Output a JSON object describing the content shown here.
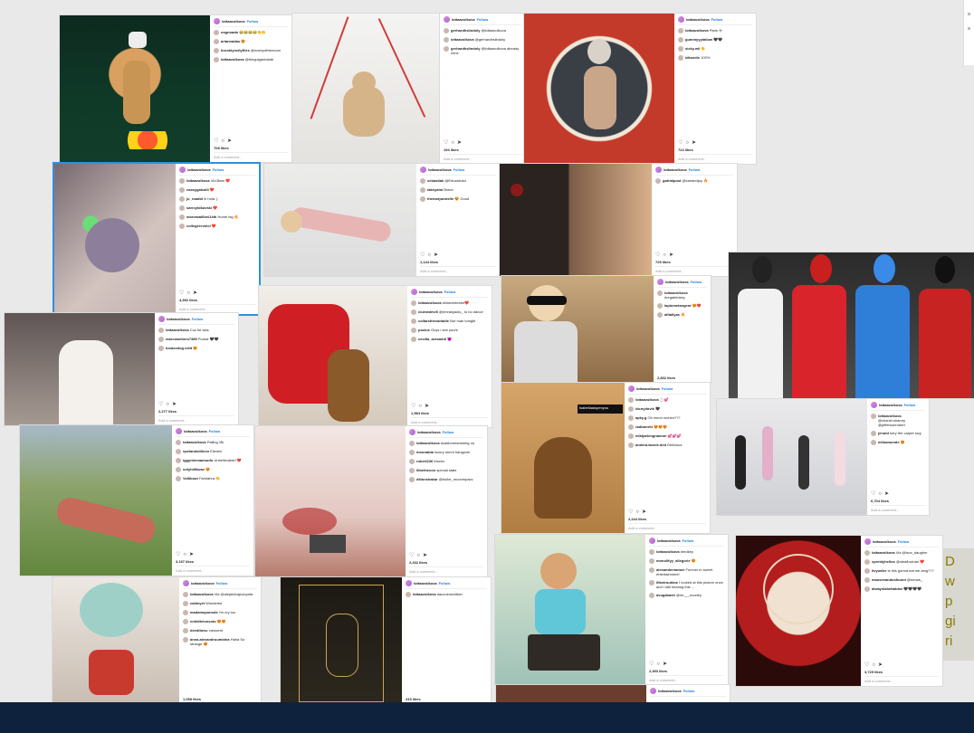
{
  "cards": [
    {
      "account": "lottaavolkova",
      "follow": "Follow",
      "comments": [
        {
          "user": "osgnoada",
          "text": "😂😂😂😂👏👏"
        },
        {
          "user": "ariannadas",
          "text": "😍"
        },
        {
          "user": "brooklyncityfiles",
          "text": "@marryofthemoon"
        },
        {
          "user": "lottaavolkova",
          "text": "@theguigantolate"
        }
      ],
      "likes": "708 likes",
      "add": "Add a comment..."
    },
    {
      "account": "",
      "follow": "",
      "comments": [],
      "likes": "",
      "add": ""
    },
    {
      "account": "lottaavolkova",
      "follow": "Follow",
      "comments": [
        {
          "user": "gerhardhslindoly",
          "text": "@lottaavolkova"
        },
        {
          "user": "lottaavolkova",
          "text": "@gerhardhslindoly"
        },
        {
          "user": "gerhardhslindoly",
          "text": "@lottaavolkova already mine"
        }
      ],
      "likes": "194 likes",
      "add": "Add a comment..."
    },
    {
      "account": "lottaavolkova",
      "follow": "Follow",
      "comments": [
        {
          "user": "lottaavolkova",
          "text": "Paris 💀"
        },
        {
          "user": "gummyyytallow",
          "text": "🖤🖤"
        },
        {
          "user": "sicky.wii",
          "text": "👏"
        },
        {
          "user": "idksmile",
          "text": "100%"
        }
      ],
      "likes": "724 likes",
      "add": "Add a comment..."
    },
    {
      "account": "lottaavolkova",
      "follow": "Follow",
      "comments": [
        {
          "user": "lottaavolkova",
          "text": "Vid.Bear ❤️"
        },
        {
          "user": "cassygalcalli",
          "text": "❤️"
        },
        {
          "user": "ju_roadid",
          "text": "hi hola :)"
        },
        {
          "user": "sarrcyldkovski",
          "text": "❤️"
        },
        {
          "user": "stonewalllbei14th",
          "text": "Home big 🔥"
        },
        {
          "user": "collegerevolcl",
          "text": "❤️"
        }
      ],
      "likes": "4,392 likes",
      "add": "Add a comment..."
    },
    {
      "account": "lottaavolkova",
      "follow": "Follow",
      "comments": [
        {
          "user": "sebastiak",
          "text": "@Eduardosd"
        },
        {
          "user": "takeyaim",
          "text": "Bravo"
        },
        {
          "user": "themarjaestelle",
          "text": "😍 Good"
        }
      ],
      "likes": "1,144 likes",
      "add": "Add a comment..."
    },
    {
      "account": "lottaavolkova",
      "follow": "Follow",
      "comments": [
        {
          "user": "gatrialpost",
          "text": "@carlandjoy 🔥"
        }
      ],
      "likes": "725 likes",
      "add": "Add a comment..."
    },
    {
      "account": "lottaavolkova",
      "follow": "Follow",
      "comments": [
        {
          "user": "lottaavolkova",
          "text": "Cuz he was"
        },
        {
          "user": "marcowebers7385",
          "text": "Poona 🖤🖤"
        },
        {
          "user": "lunaxedog.ezitt",
          "text": "😍"
        }
      ],
      "likes": "2,277 likes",
      "add": "Add a comment..."
    },
    {
      "account": "lottaavolkova",
      "follow": "Follow",
      "comments": [
        {
          "user": "lottaavolkova",
          "text": "#limezeitenhe❤️"
        },
        {
          "user": "cluestdevill",
          "text": "@emranjacks_ to no dance"
        },
        {
          "user": "collarsthevariable",
          "text": "Not man tonight"
        },
        {
          "user": "pociux",
          "text": "Guys i see yours"
        },
        {
          "user": "cecilia_avramidi",
          "text": "😈"
        }
      ],
      "likes": "1,984 likes",
      "add": "Add a comment..."
    },
    {
      "account": "lottaavolkova",
      "follow": "Follow",
      "comments": [
        {
          "user": "lottaavolkova",
          "text": "#regalelokey"
        },
        {
          "user": "laplumetangent",
          "text": "😍❤️"
        },
        {
          "user": "alltallyas",
          "text": "🔥"
        }
      ],
      "likes": "2,832 likes",
      "add": "Add a comment..."
    },
    {
      "account": "",
      "follow": "",
      "comments": [],
      "likes": "",
      "add": ""
    },
    {
      "account": "lottaavolkova",
      "follow": "Follow",
      "comments": [
        {
          "user": "lottaavolkova",
          "text": "💍💕"
        },
        {
          "user": "idcnydovik",
          "text": "🖤"
        },
        {
          "user": "apky.g",
          "text": "Oh merci rochim???"
        },
        {
          "user": "radbarrett",
          "text": "😍😍😍"
        },
        {
          "user": "mlktjarkingnamon",
          "text": "💕💕💕"
        },
        {
          "user": "andera.tavole.ded",
          "text": "Delicious"
        }
      ],
      "likes": "2,244 likes",
      "add": "Add a comment..."
    },
    {
      "account": "lottaavolkova",
      "follow": "Follow",
      "comments": [
        {
          "user": "lottaavolkova",
          "text": "@chanel.shamry @jeffersonrobert"
        },
        {
          "user": "jenold",
          "text": "lorry the carpet lucy"
        },
        {
          "user": "miloamunde",
          "text": "😍"
        }
      ],
      "likes": "6,704 likes",
      "add": "Add a comment..."
    },
    {
      "account": "lottaavolkova",
      "follow": "Follow",
      "comments": [
        {
          "user": "lottaavolkova",
          "text": "Palling Vik"
        },
        {
          "user": "epelandstillcon",
          "text": "Electric"
        },
        {
          "user": "iggynhemamunfo",
          "text": "Unbelievable! ❤️"
        },
        {
          "user": "onlyhiilliamz",
          "text": "😍"
        },
        {
          "user": "Voliiboot",
          "text": "Fahrlahra 👏"
        }
      ],
      "likes": "3,197 likes",
      "add": "Add a comment..."
    },
    {
      "account": "lottaavolkova",
      "follow": "Follow",
      "comments": [
        {
          "user": "lottaavolkova",
          "text": "#cadlorenamming va"
        },
        {
          "user": "moonalda",
          "text": "luxury mmm hangover"
        },
        {
          "user": "robert236",
          "text": "Mucho"
        },
        {
          "user": "lilbethecon",
          "text": "special state"
        },
        {
          "user": "dillonshakar",
          "text": "@bulbe_moonmpacs"
        }
      ],
      "likes": "2,432 likes",
      "add": "Add a comment..."
    },
    {
      "account": "lottaavolkova",
      "follow": "Follow",
      "comments": [
        {
          "user": "lottaavolkova",
          "text": "#redkey"
        },
        {
          "user": "monolifyy_allegorie",
          "text": "😍"
        },
        {
          "user": "alexandernamee",
          "text": "Forever in sweet entertainment!"
        },
        {
          "user": "lifaxtrouktoe",
          "text": "I looked at this picture once and I still hearing this ..."
        },
        {
          "user": "avugabash",
          "text": "@im___ecodey"
        }
      ],
      "likes": "2,393 likes",
      "add": "Add a comment..."
    },
    {
      "account": "lottaavolkova",
      "follow": "Follow",
      "comments": [
        {
          "user": "lottaavolkova",
          "text": "Via @isoc_daughm"
        },
        {
          "user": "cpreidyhellos",
          "text": "@sleaflovinas ❤️"
        },
        {
          "user": "livyodier",
          "text": "is this gonna eat me lang???"
        },
        {
          "user": "mausexandusfound",
          "text": "@tomas_"
        },
        {
          "user": "alwayslabettatdse",
          "text": "🖤🖤🖤🖤"
        }
      ],
      "likes": "3,725 likes",
      "add": "Add a comment..."
    },
    {
      "account": "lottaavolkova",
      "follow": "Follow",
      "comments": [
        {
          "user": "lottaavolkova",
          "text": "Via @alejandrapulopida"
        },
        {
          "user": "caldeyet",
          "text": "Wonderful"
        },
        {
          "user": "madameponode",
          "text": "I'm cry too"
        },
        {
          "user": "entiditelonsoto",
          "text": "😍😍"
        },
        {
          "user": "deedibesc",
          "text": "creaxent"
        },
        {
          "user": "anna.alexandruumbina",
          "text": "Haha So strange 😍"
        }
      ],
      "likes": "1,098 likes",
      "add": "Add a comment..."
    },
    {
      "account": "lottaavolkova",
      "follow": "Follow",
      "comments": [
        {
          "user": "lottaavolkova",
          "text": "#aucolronixittan"
        }
      ],
      "likes": "415 likes",
      "add": "Add a comment..."
    },
    {
      "account": "lottaavolkova",
      "follow": "Follow",
      "comments": [],
      "likes": "",
      "add": ""
    }
  ],
  "tag_label": "Isabellaalopenyou",
  "caption_fragment": [
    "D",
    "w",
    "p",
    "gi",
    "ri"
  ],
  "colors": {
    "selection": "#2f8fe0",
    "follow": "#1b7fe0",
    "background": "#e9e9e9",
    "bottom_bar": "#0f223d"
  }
}
